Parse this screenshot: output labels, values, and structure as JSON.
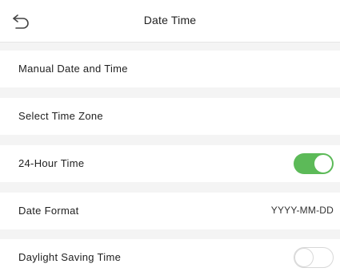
{
  "header": {
    "back_icon": "back-arrow-icon",
    "title": "Date Time"
  },
  "rows": [
    {
      "label": "Manual Date and Time"
    },
    {
      "label": "Select Time Zone"
    },
    {
      "label": "24-Hour Time",
      "toggle": true,
      "enabled": true
    },
    {
      "label": "Date Format",
      "value": "YYYY-MM-DD"
    },
    {
      "label": "Daylight Saving Time",
      "toggle": true,
      "enabled": false
    }
  ],
  "colors": {
    "toggle_on": "#5cba58",
    "background": "#f4f4f4"
  }
}
